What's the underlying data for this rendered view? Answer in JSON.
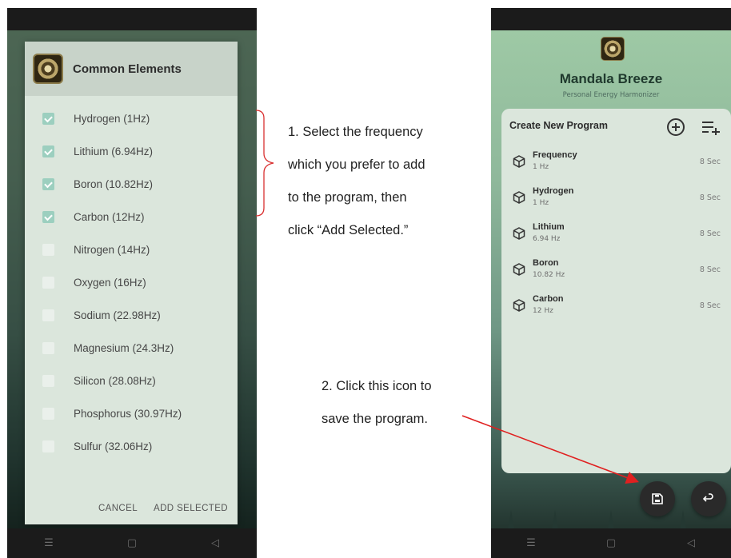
{
  "left_phone": {
    "dialog": {
      "title": "Common Elements",
      "items": [
        {
          "label": "Hydrogen (1Hz)",
          "checked": true
        },
        {
          "label": "Lithium (6.94Hz)",
          "checked": true
        },
        {
          "label": "Boron (10.82Hz)",
          "checked": true
        },
        {
          "label": "Carbon (12Hz)",
          "checked": true
        },
        {
          "label": "Nitrogen (14Hz)",
          "checked": false
        },
        {
          "label": "Oxygen (16Hz)",
          "checked": false
        },
        {
          "label": "Sodium (22.98Hz)",
          "checked": false
        },
        {
          "label": "Magnesium (24.3Hz)",
          "checked": false
        },
        {
          "label": "Silicon (28.08Hz)",
          "checked": false
        },
        {
          "label": "Phosphorus (30.97Hz)",
          "checked": false
        },
        {
          "label": "Sulfur (32.06Hz)",
          "checked": false
        }
      ],
      "cancel_label": "CANCEL",
      "add_selected_label": "ADD SELECTED"
    },
    "nav": {
      "menu": "☰",
      "home": "▢",
      "back": "◁"
    }
  },
  "annotations": {
    "note1": [
      "1. Select the frequency",
      "which you prefer to add",
      "to the program, then",
      "click “Add Selected.”"
    ],
    "note2": [
      "2. Click this icon to",
      "save the program."
    ],
    "arrow_color": "#e02020"
  },
  "right_phone": {
    "app_title": "Mandala Breeze",
    "app_subtitle": "Personal Energy Harmonizer",
    "card_title": "Create New Program",
    "programs": [
      {
        "name": "Frequency",
        "freq": "1 Hz",
        "duration": "8 Sec"
      },
      {
        "name": "Hydrogen",
        "freq": "1 Hz",
        "duration": "8 Sec"
      },
      {
        "name": "Lithium",
        "freq": "6.94 Hz",
        "duration": "8 Sec"
      },
      {
        "name": "Boron",
        "freq": "10.82 Hz",
        "duration": "8 Sec"
      },
      {
        "name": "Carbon",
        "freq": "12 Hz",
        "duration": "8 Sec"
      }
    ],
    "icons": {
      "add": "plus-circle-icon",
      "add_list": "playlist-add-icon",
      "save": "floppy-disk-icon",
      "back": "undo-icon",
      "program": "cube-icon"
    },
    "nav": {
      "menu": "☰",
      "home": "▢",
      "back": "◁"
    }
  }
}
